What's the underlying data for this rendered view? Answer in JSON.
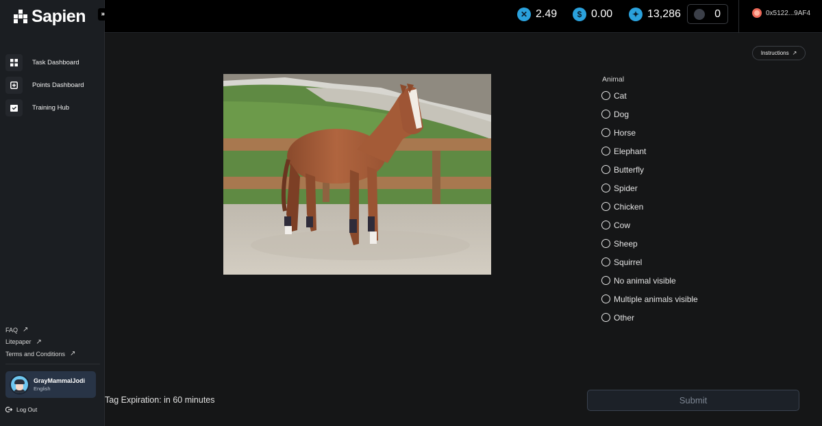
{
  "app": {
    "name": "Sapien",
    "collapse_glyph": "⇤"
  },
  "sidebar": {
    "items": [
      {
        "label": "Task Dashboard",
        "icon": "grid-icon"
      },
      {
        "label": "Points Dashboard",
        "icon": "plus-square-icon"
      },
      {
        "label": "Training Hub",
        "icon": "box-check-icon"
      }
    ],
    "links": [
      {
        "label": "FAQ",
        "icon": "external-arrow-icon"
      },
      {
        "label": "Litepaper",
        "icon": "external-arrow-icon"
      },
      {
        "label": "Terms and Conditions",
        "icon": "external-arrow-icon"
      }
    ],
    "user": {
      "name": "GrayMammalJodi",
      "language": "English"
    },
    "logout_label": "Log Out"
  },
  "header": {
    "stats": [
      {
        "icon": "x-coin-icon",
        "glyph": "✕",
        "value": "2.49"
      },
      {
        "icon": "dollar-coin-icon",
        "glyph": "$",
        "value": "0.00"
      },
      {
        "icon": "sparkle-coin-icon",
        "glyph": "✦",
        "value": "13,286"
      }
    ],
    "box_stat": {
      "icon": "dark-token-icon",
      "value": "0"
    },
    "wallet": "0x5122...9AF4"
  },
  "task": {
    "instructions_label": "Instructions",
    "question_label": "Animal",
    "options": [
      "Cat",
      "Dog",
      "Horse",
      "Elephant",
      "Butterfly",
      "Spider",
      "Chicken",
      "Cow",
      "Sheep",
      "Squirrel",
      "No animal visible",
      "Multiple animals visible",
      "Other"
    ],
    "expiration": "Tag Expiration: in 60 minutes",
    "submit_label": "Submit"
  },
  "colors": {
    "accent": "#2aa1dc",
    "background": "#151617",
    "sidebar": "#1b1e22",
    "wallet": "#ef6a5a"
  }
}
